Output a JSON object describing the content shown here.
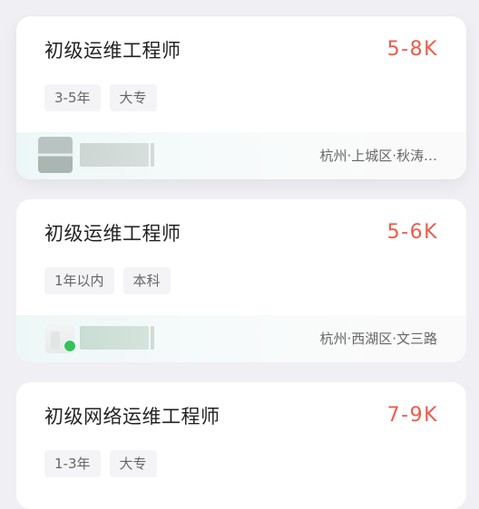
{
  "jobs": [
    {
      "title": "初级运维工程师",
      "salary": "5-8K",
      "tags": [
        "3-5年",
        "大专"
      ],
      "location": "杭州·上城区·秋涛…",
      "logo_icon": "company-logo-icon"
    },
    {
      "title": "初级运维工程师",
      "salary": "5-6K",
      "tags": [
        "1年以内",
        "本科"
      ],
      "location": "杭州·西湖区·文三路",
      "logo_icon": "building-icon",
      "online_status_color": "#35c25a"
    },
    {
      "title": "初级网络运维工程师",
      "salary": "7-9K",
      "tags": [
        "1-3年",
        "大专"
      ]
    }
  ],
  "colors": {
    "salary": "#f05a4a",
    "background": "#efeff4"
  }
}
